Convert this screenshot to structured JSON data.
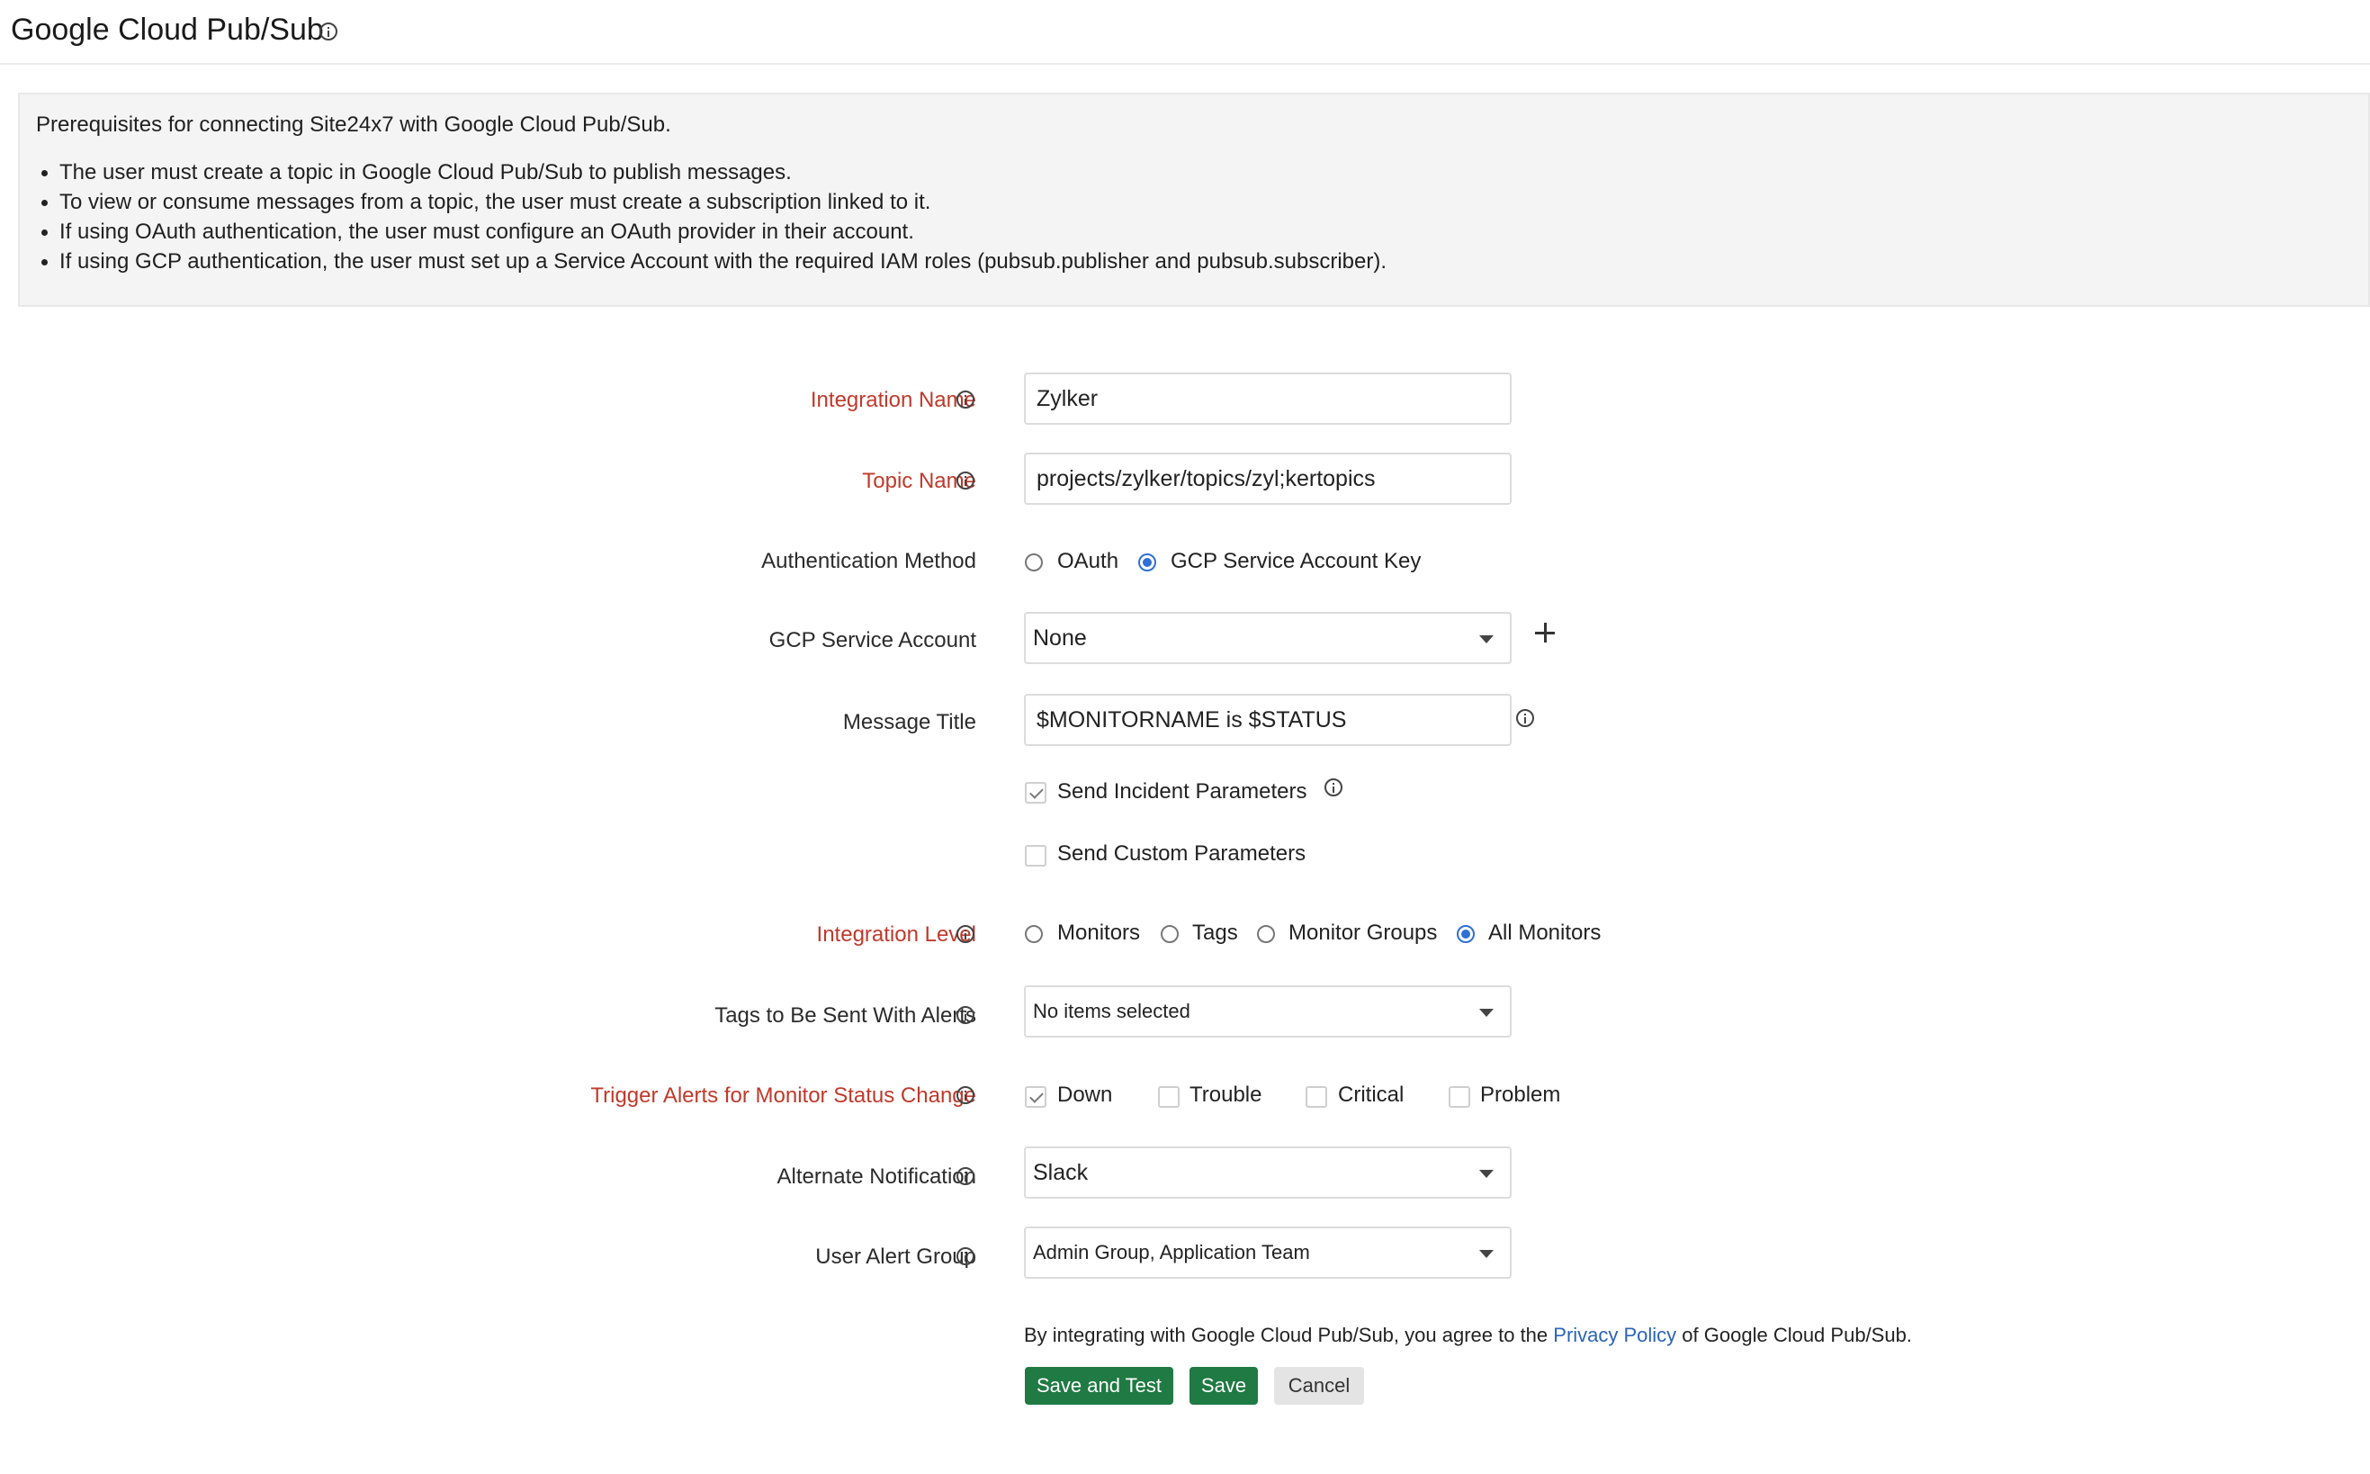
{
  "header": {
    "title": "Google Cloud Pub/Sub"
  },
  "prerequisites": {
    "intro": "Prerequisites for connecting Site24x7 with Google Cloud Pub/Sub.",
    "items": [
      "The user must create a topic in Google Cloud Pub/Sub to publish messages.",
      "To view or consume messages from a topic, the user must create a subscription linked to it.",
      "If using OAuth authentication, the user must configure an OAuth provider in their account.",
      "If using GCP authentication, the user must set up a Service Account with the required IAM roles (pubsub.publisher and pubsub.subscriber)."
    ]
  },
  "form": {
    "integration_name": {
      "label": "Integration Name",
      "value": "Zylker"
    },
    "topic_name": {
      "label": "Topic Name",
      "value": "projects/zylker/topics/zyl;kertopics"
    },
    "auth_method": {
      "label": "Authentication Method",
      "options": [
        "OAuth",
        "GCP Service Account Key"
      ],
      "selected": "GCP Service Account Key"
    },
    "gcp_service_account": {
      "label": "GCP Service Account",
      "value": "None"
    },
    "message_title": {
      "label": "Message Title",
      "value": "$MONITORNAME is $STATUS"
    },
    "send_incident_parameters": {
      "label": "Send Incident Parameters",
      "checked": true
    },
    "send_custom_parameters": {
      "label": "Send Custom Parameters",
      "checked": false
    },
    "integration_level": {
      "label": "Integration Level",
      "options": [
        "Monitors",
        "Tags",
        "Monitor Groups",
        "All Monitors"
      ],
      "selected": "All Monitors"
    },
    "tags_sent": {
      "label": "Tags to Be Sent With Alerts",
      "value": "No items selected"
    },
    "trigger_alerts": {
      "label": "Trigger Alerts for Monitor Status Change",
      "options": [
        {
          "label": "Down",
          "checked": true
        },
        {
          "label": "Trouble",
          "checked": false
        },
        {
          "label": "Critical",
          "checked": false
        },
        {
          "label": "Problem",
          "checked": false
        }
      ]
    },
    "alternate_notification": {
      "label": "Alternate Notification",
      "value": "Slack"
    },
    "user_alert_group": {
      "label": "User Alert Group",
      "value": "Admin Group, Application Team"
    }
  },
  "agreement": {
    "prefix": "By integrating with Google Cloud Pub/Sub, you agree to the ",
    "link": "Privacy Policy",
    "suffix": " of Google Cloud Pub/Sub."
  },
  "buttons": {
    "save_and_test": "Save and Test",
    "save": "Save",
    "cancel": "Cancel"
  },
  "colors": {
    "required_label": "#c0392b",
    "primary_button": "#1f7a43",
    "link": "#2a63b8",
    "radio_selected": "#2f6fd6"
  }
}
